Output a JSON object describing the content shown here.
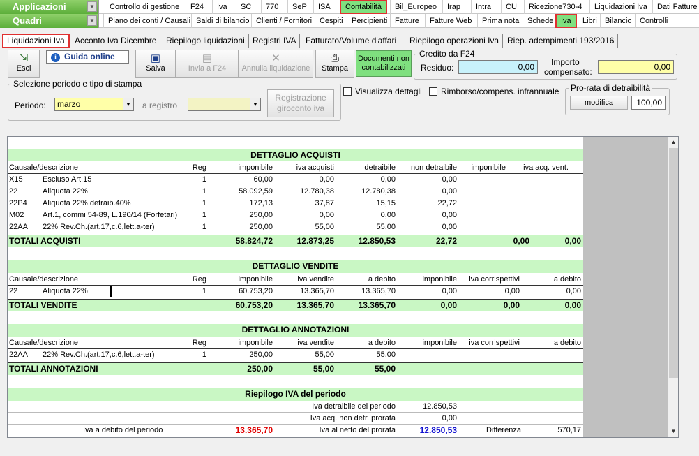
{
  "menu1": {
    "left": "Applicazioni",
    "items": [
      "Controllo di gestione",
      "F24",
      "Iva",
      "SC",
      "770",
      "SeP",
      "ISA",
      "Contabilità",
      "Bil_Europeo",
      "Irap",
      "Intra",
      "CU",
      "Ricezione730-4",
      "Liquidazioni Iva",
      "Dati Fatture"
    ]
  },
  "menu2": {
    "left": "Quadri",
    "items": [
      "Piano dei conti / Causali",
      "Saldi di bilancio",
      "Clienti / Fornitori",
      "Cespiti",
      "Percipienti",
      "Fatture",
      "Fatture Web",
      "Prima nota",
      "Schede",
      "Iva",
      "Libri",
      "Bilancio",
      "Controlli"
    ]
  },
  "tabs": [
    "Liquidazioni Iva",
    "Acconto Iva Dicembre",
    "Riepilogo liquidazioni",
    "Registri IVA",
    "Fatturato/Volume d'affari",
    "Riepilogo operazioni Iva",
    "Riep. adempimenti 193/2016"
  ],
  "toolbar": {
    "esci": "Esci",
    "guida": "Guida online",
    "salva": "Salva",
    "invia": "Invia a F24",
    "annulla": "Annulla liquidazione",
    "stampa": "Stampa",
    "documenti": "Documenti non contabilizzati"
  },
  "credito": {
    "legend": "Credito da F24",
    "residuo_label": "Residuo:",
    "residuo": "0,00",
    "importo_label1": "Importo",
    "importo_label2": "compensato:",
    "importo": "0,00"
  },
  "selezione": {
    "legend": "Selezione periodo e tipo di stampa",
    "periodo_label": "Periodo:",
    "periodo": "marzo",
    "registro_label": "a registro",
    "registro": "",
    "reg_btn1": "Registrazione",
    "reg_btn2": "giroconto iva",
    "visualizza": "Visualizza dettagli",
    "rimborso": "Rimborso/compens. infrannuale"
  },
  "prorata": {
    "legend": "Pro-rata di detraibilità",
    "modifica": "modifica",
    "valore": "100,00"
  },
  "acquisti": {
    "title": "DETTAGLIO ACQUISTI",
    "headers": [
      "Causale/descrizione",
      "Reg",
      "imponibile",
      "iva acquisti",
      "detraibile",
      "non detraibile",
      "imponibile",
      "iva acq. vent."
    ],
    "rows": [
      [
        "X15",
        "Escluso Art.15",
        "1",
        "60,00",
        "0,00",
        "0,00",
        "0,00"
      ],
      [
        "22",
        "Aliquota 22%",
        "1",
        "58.092,59",
        "12.780,38",
        "12.780,38",
        "0,00"
      ],
      [
        "22P4",
        "Aliquota 22% detraib.40%",
        "1",
        "172,13",
        "37,87",
        "15,15",
        "22,72"
      ],
      [
        "M02",
        "Art.1, commi 54-89, L.190/14 (Forfetari)",
        "1",
        "250,00",
        "0,00",
        "0,00",
        "0,00"
      ],
      [
        "22AA",
        "22% Rev.Ch.(art.17,c.6,lett.a-ter)",
        "1",
        "250,00",
        "55,00",
        "55,00",
        "0,00"
      ]
    ],
    "totals": [
      "TOTALI ACQUISTI",
      "58.824,72",
      "12.873,25",
      "12.850,53",
      "22,72",
      "0,00",
      "0,00"
    ]
  },
  "vendite": {
    "title": "DETTAGLIO VENDITE",
    "headers": [
      "Causale/descrizione",
      "Reg",
      "imponibile",
      "iva vendite",
      "a debito",
      "imponibile",
      "iva corrispettivi",
      "a debito"
    ],
    "rows": [
      [
        "22",
        "Aliquota 22%",
        "1",
        "60.753,20",
        "13.365,70",
        "13.365,70",
        "0,00",
        "0,00",
        "0,00"
      ]
    ],
    "totals": [
      "TOTALI VENDITE",
      "60.753,20",
      "13.365,70",
      "13.365,70",
      "0,00",
      "0,00",
      "0,00"
    ]
  },
  "annotazioni": {
    "title": "DETTAGLIO ANNOTAZIONI",
    "headers": [
      "Causale/descrizione",
      "Reg",
      "imponibile",
      "iva vendite",
      "a debito",
      "imponibile",
      "iva corrispettivi",
      "a debito"
    ],
    "rows": [
      [
        "22AA",
        "22% Rev.Ch.(art.17,c.6,lett.a-ter)",
        "1",
        "250,00",
        "55,00",
        "55,00"
      ]
    ],
    "totals": [
      "TOTALI ANNOTAZIONI",
      "250,00",
      "55,00",
      "55,00"
    ]
  },
  "riepilogo": {
    "title": "Riepilogo IVA del periodo",
    "detraibile_label": "Iva detraibile del periodo",
    "detraibile": "12.850,53",
    "nondetr_label": "Iva acq. non detr. prorata",
    "nondetr": "0,00",
    "debito_label": "Iva a debito del periodo",
    "debito": "13.365,70",
    "netto_label": "Iva al netto del prorata",
    "netto": "12.850,53",
    "diff_label": "Differenza",
    "diff": "570,17"
  }
}
